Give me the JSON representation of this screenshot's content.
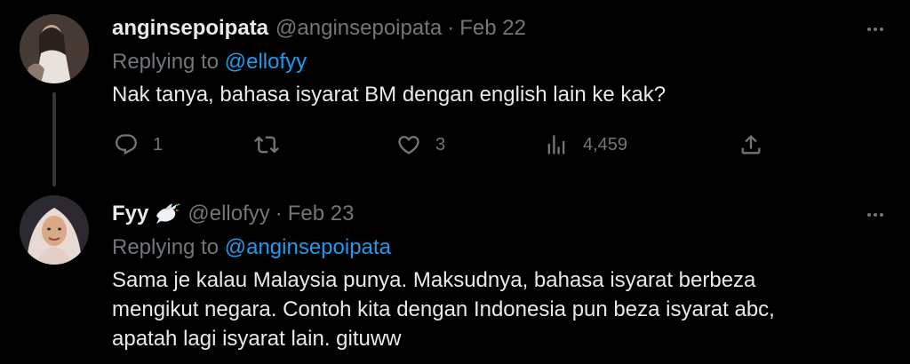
{
  "tweets": [
    {
      "name": "anginsepoipata",
      "handle": "@anginsepoipata",
      "separator": "·",
      "date": "Feb 22",
      "replying_prefix": "Replying to",
      "replying_to": "@ellofyy",
      "text": "Nak tanya, bahasa isyarat BM dengan english lain ke kak?",
      "stats": {
        "replies": "1",
        "retweets": "",
        "likes": "3",
        "views": "4,459"
      }
    },
    {
      "name": "Fyy",
      "handle": "@ellofyy",
      "separator": "·",
      "date": "Feb 23",
      "replying_prefix": "Replying to",
      "replying_to": "@anginsepoipata",
      "text_lines": [
        "Sama je kalau Malaysia punya. Maksudnya, bahasa isyarat berbeza",
        "mengikut negara. Contoh kita dengan Indonesia pun beza isyarat abc,",
        "apatah lagi isyarat lain. gituww"
      ]
    }
  ],
  "colors": {
    "background": "#000000",
    "text": "#e7e9ea",
    "muted": "#71767b",
    "link": "#1d9bf0"
  },
  "icons": [
    "reply-icon",
    "retweet-icon",
    "like-icon",
    "views-icon",
    "share-icon",
    "more-icon",
    "dove-emoji-icon"
  ]
}
